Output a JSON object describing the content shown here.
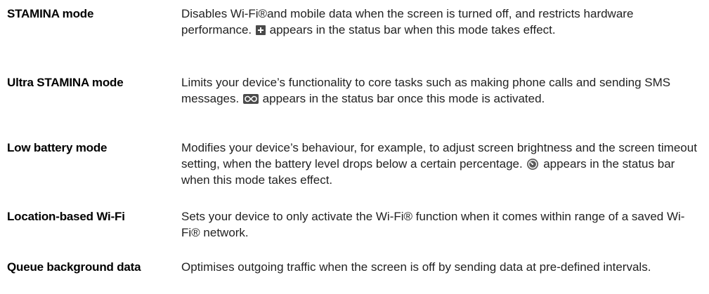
{
  "rows": [
    {
      "term": "STAMINA mode",
      "desc_before": "Disables Wi-Fi®and mobile data when the screen is turned off, and restricts hardware performance. ",
      "icon": "stamina-plus-icon",
      "desc_after": " appears in the status bar when this mode takes effect."
    },
    {
      "term": "Ultra STAMINA mode",
      "desc_before": "Limits your device’s functionality to core tasks such as making phone calls and sending SMS messages. ",
      "icon": "ultra-stamina-infinity-icon",
      "desc_after": " appears in the status bar once this mode is activated."
    },
    {
      "term": "Low battery mode",
      "desc_before": "Modifies your device’s behaviour, for example, to adjust screen brightness and the screen timeout setting, when the battery level drops below a certain percentage. ",
      "icon": "low-battery-gauge-icon",
      "desc_after": " appears in the status bar when this mode takes effect."
    },
    {
      "term": "Location-based Wi-Fi",
      "desc": "Sets your device to only activate the Wi-Fi® function when it comes within range of a saved Wi-Fi® network."
    },
    {
      "term": "Queue background data",
      "desc": "Optimises outgoing traffic when the screen is off by sending data at pre-defined intervals."
    }
  ]
}
